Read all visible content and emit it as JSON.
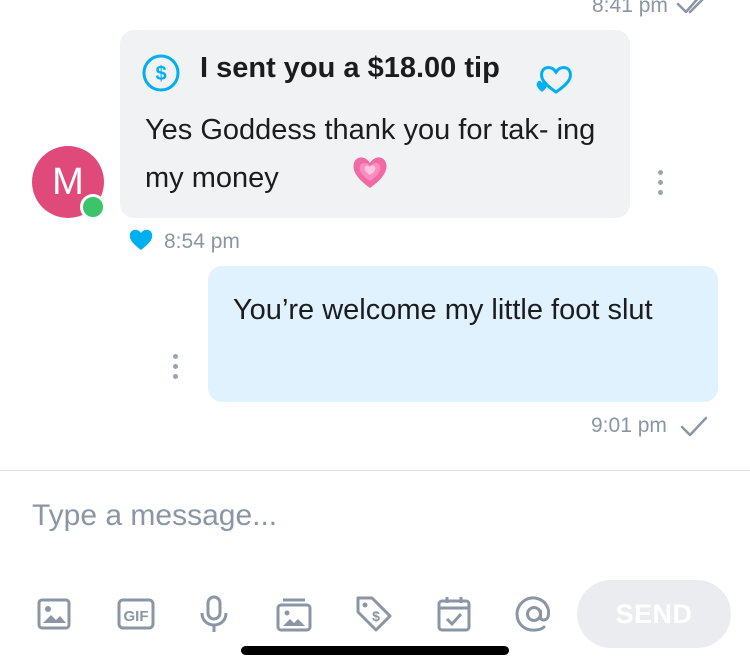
{
  "colors": {
    "accent": "#00aff0",
    "incoming_bubble": "#f1f2f4",
    "outgoing_bubble": "#dff2fd",
    "avatar_bg": "#e04a7a",
    "online_dot": "#3cc46a",
    "meta_text": "#8a96a3"
  },
  "previous_message": {
    "time": "8:41 pm",
    "status_icon": "double-check-icon"
  },
  "incoming_message": {
    "avatar_initial": "M",
    "tip_label": "I sent you a $18.00 tip",
    "tip_icon": "dollar-circle-icon",
    "text": "Yes Goddess thank you for tak- ing my money",
    "emoji": "growing-heart-emoji",
    "time": "8:54 pm",
    "liked": true
  },
  "outgoing_message": {
    "text": "You’re welcome my little foot slut",
    "time": "9:01 pm",
    "status_icon": "check-icon"
  },
  "composer": {
    "placeholder": "Type a message...",
    "send_label": "SEND",
    "tools": [
      "image-icon",
      "gif-icon",
      "microphone-icon",
      "vault-icon",
      "price-tag-icon",
      "calendar-icon",
      "mention-icon"
    ]
  }
}
